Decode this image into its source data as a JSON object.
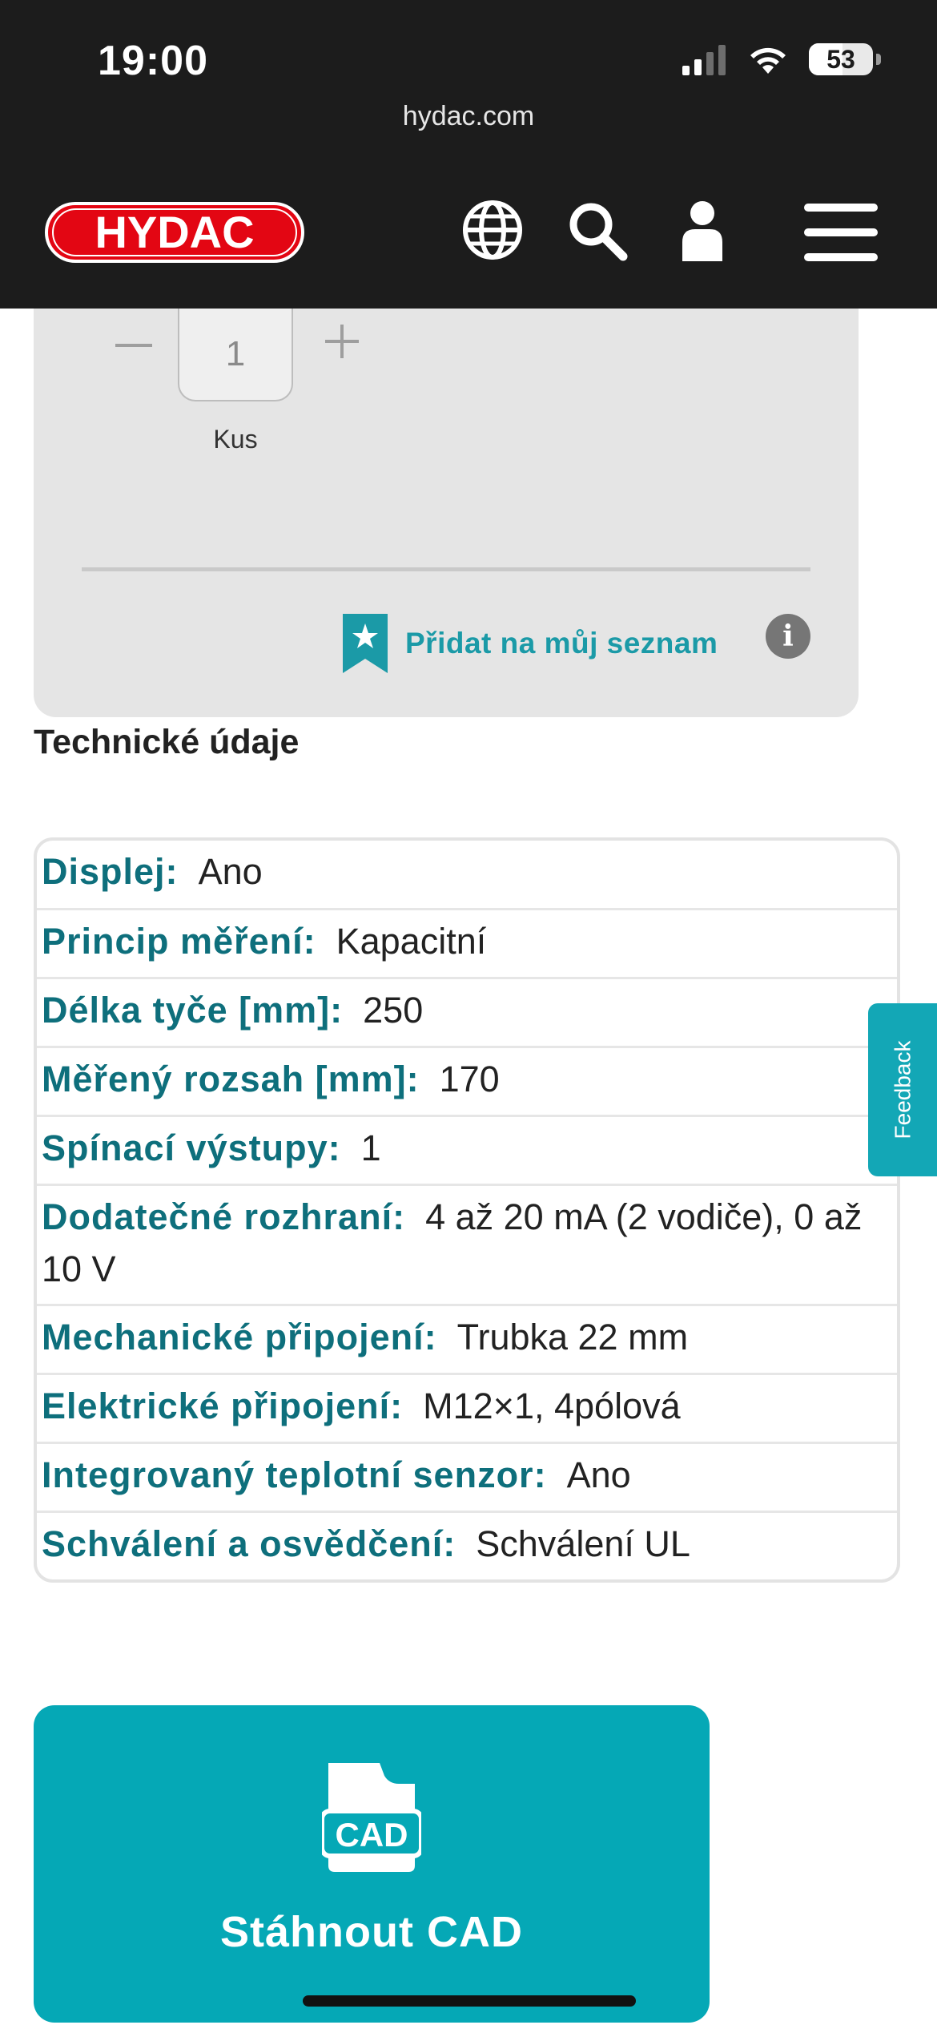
{
  "status_bar": {
    "time": "19:00",
    "battery": "53"
  },
  "browser": {
    "url": "hydac.com"
  },
  "header": {
    "logo_text": "HYDAC",
    "icons": [
      "globe-icon",
      "search-icon",
      "user-icon",
      "menu-icon"
    ]
  },
  "quantity": {
    "value": "1",
    "unit": "Kus"
  },
  "wishlist": {
    "label": "Přidat na můj seznam",
    "info": "i"
  },
  "tech": {
    "title": "Technické údaje",
    "rows": [
      {
        "key": "Displej:",
        "value": "Ano"
      },
      {
        "key": "Princip měření:",
        "value": "Kapacitní"
      },
      {
        "key": "Délka tyče [mm]:",
        "value": "250"
      },
      {
        "key": "Měřený rozsah [mm]:",
        "value": "170"
      },
      {
        "key": "Spínací výstupy:",
        "value": "1"
      },
      {
        "key": "Dodatečné rozhraní:",
        "value": "4 až 20 mA (2 vodiče), 0 až 10 V"
      },
      {
        "key": "Mechanické připojení:",
        "value": "Trubka 22 mm"
      },
      {
        "key": "Elektrické připojení:",
        "value": "M12×1, 4pólová"
      },
      {
        "key": "Integrovaný teplotní senzor:",
        "value": "Ano"
      },
      {
        "key": "Schválení a osvědčení:",
        "value": "Schválení UL"
      }
    ]
  },
  "feedback": {
    "label": "Feedback"
  },
  "cad": {
    "icon_text": "CAD",
    "label": "Stáhnout CAD"
  },
  "colors": {
    "accent": "#05a8b6",
    "key_text": "#0e6f7c",
    "logo_red": "#e30613",
    "header_bg": "#1c1c1c"
  }
}
